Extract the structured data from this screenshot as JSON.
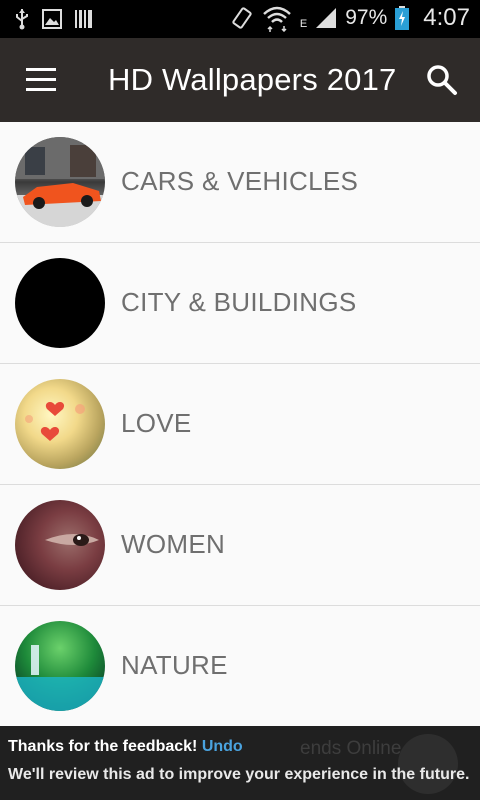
{
  "status_bar": {
    "battery": "97%",
    "time": "4:07",
    "network_type": "E"
  },
  "app_bar": {
    "title": "HD Wallpapers 2017"
  },
  "categories": [
    {
      "label": "CARS & VEHICLES"
    },
    {
      "label": "CITY & BUILDINGS"
    },
    {
      "label": "LOVE"
    },
    {
      "label": "WOMEN"
    },
    {
      "label": "NATURE"
    }
  ],
  "ad_feedback": {
    "message": "Thanks for the feedback!",
    "undo_label": "Undo",
    "detail": "We'll review this ad to improve your experience in the future.",
    "background_text": "ends Online. Join"
  },
  "colors": {
    "app_bar": "#2f2b29",
    "status_bar": "#000000",
    "label_text": "#6f6f6f",
    "undo_link": "#4aa3df"
  }
}
